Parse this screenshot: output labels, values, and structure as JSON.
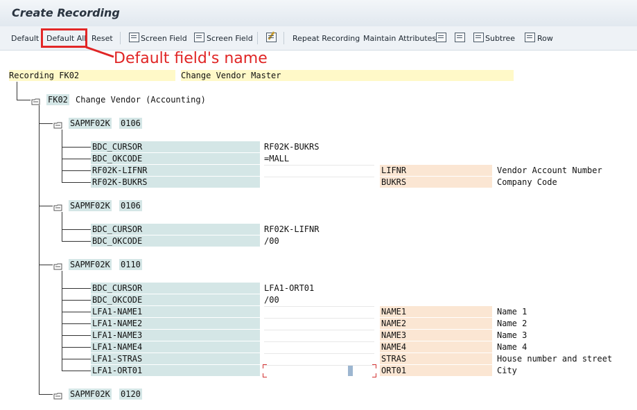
{
  "window": {
    "title": "Create Recording"
  },
  "toolbar": {
    "default": "Default",
    "default_all": "Default All",
    "reset": "Reset",
    "screen_field_1": "Screen Field",
    "screen_field_2": "Screen Field",
    "repeat_recording": "Repeat Recording",
    "maintain_attributes": "Maintain Attributes",
    "subtree": "Subtree",
    "row": "Row"
  },
  "annotation": {
    "text": "Default field's name",
    "color": "#e02525"
  },
  "recording": {
    "label": "Recording FK02",
    "description": "Change Vendor Master"
  },
  "transaction": {
    "code": "FK02",
    "name": "Change Vendor (Accounting)"
  },
  "screens": [
    {
      "program": "SAPMF02K",
      "number": "0106",
      "fields": [
        {
          "name": "BDC_CURSOR",
          "value": "RF02K-BUKRS"
        },
        {
          "name": "BDC_OKCODE",
          "value": "=MALL"
        },
        {
          "name": "RF02K-LIFNR",
          "value": "",
          "screen_field": "LIFNR",
          "description": "Vendor Account Number"
        },
        {
          "name": "RF02K-BUKRS",
          "value": "",
          "screen_field": "BUKRS",
          "description": "Company Code"
        }
      ]
    },
    {
      "program": "SAPMF02K",
      "number": "0106",
      "fields": [
        {
          "name": "BDC_CURSOR",
          "value": "RF02K-LIFNR"
        },
        {
          "name": "BDC_OKCODE",
          "value": "/00"
        }
      ]
    },
    {
      "program": "SAPMF02K",
      "number": "0110",
      "fields": [
        {
          "name": "BDC_CURSOR",
          "value": "LFA1-ORT01"
        },
        {
          "name": "BDC_OKCODE",
          "value": "/00"
        },
        {
          "name": "LFA1-NAME1",
          "value": "",
          "screen_field": "NAME1",
          "description": "Name 1"
        },
        {
          "name": "LFA1-NAME2",
          "value": "",
          "screen_field": "NAME2",
          "description": "Name 2"
        },
        {
          "name": "LFA1-NAME3",
          "value": "",
          "screen_field": "NAME3",
          "description": "Name 3"
        },
        {
          "name": "LFA1-NAME4",
          "value": "",
          "screen_field": "NAME4",
          "description": "Name 4"
        },
        {
          "name": "LFA1-STRAS",
          "value": "",
          "screen_field": "STRAS",
          "description": "House number and street"
        },
        {
          "name": "LFA1-ORT01",
          "value": "",
          "screen_field": "ORT01",
          "description": "City"
        }
      ]
    },
    {
      "program": "SAPMF02K",
      "number": "0120",
      "fields": []
    }
  ]
}
